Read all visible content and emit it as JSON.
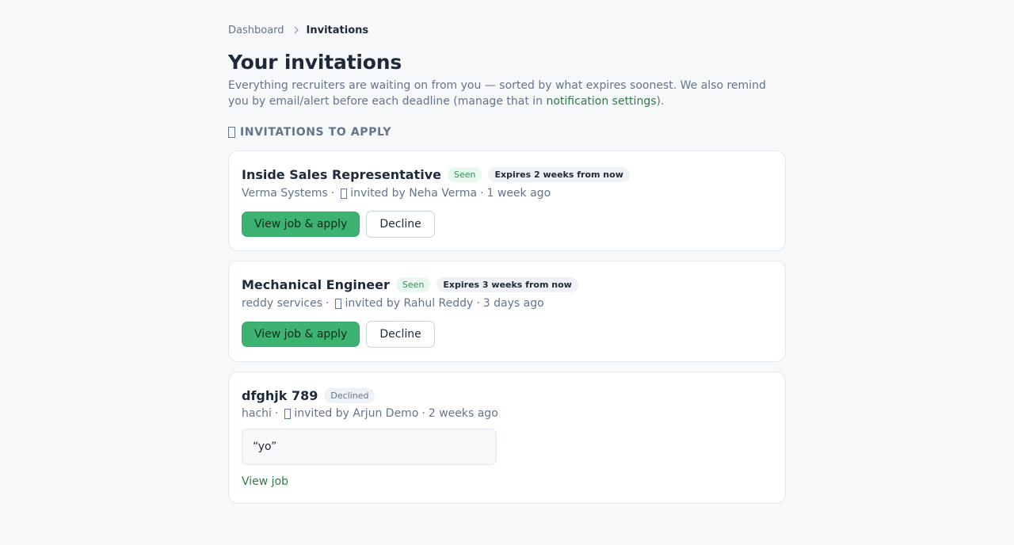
{
  "breadcrumb": {
    "parent": "Dashboard",
    "current": "Invitations"
  },
  "page": {
    "title": "Your invitations",
    "description_prefix": "Everything recruiters are waiting on from you — sorted by what expires soonest. We also remind you by email/alert before each deadline (manage that in ",
    "description_link": "notification settings",
    "description_suffix": ")."
  },
  "section": {
    "title": "INVITATIONS TO APPLY",
    "icon": "envelope-icon"
  },
  "invitations": [
    {
      "title": "Inside Sales Representative",
      "status_badge": "Seen",
      "expiry_badge": "Expires 2 weeks from now",
      "company": "Verma Systems",
      "invited_by": "invited by Neha Verma",
      "ago": "1 week ago",
      "primary_action": "View job & apply",
      "secondary_action": "Decline"
    },
    {
      "title": "Mechanical Engineer",
      "status_badge": "Seen",
      "expiry_badge": "Expires 3 weeks from now",
      "company": "reddy services",
      "invited_by": "invited by Rahul Reddy",
      "ago": "3 days ago",
      "primary_action": "View job & apply",
      "secondary_action": "Decline"
    },
    {
      "title": "dfghjk 789",
      "status_badge": "Declined",
      "company": "hachi",
      "invited_by": "invited by Arjun Demo",
      "ago": "2 weeks ago",
      "note": "“yo”",
      "link": "View job"
    }
  ],
  "colors": {
    "accent": "#3cb371",
    "link": "#2f7a4b",
    "muted": "#64748b",
    "background": "#f7f8fa"
  },
  "meta_separator": "·"
}
